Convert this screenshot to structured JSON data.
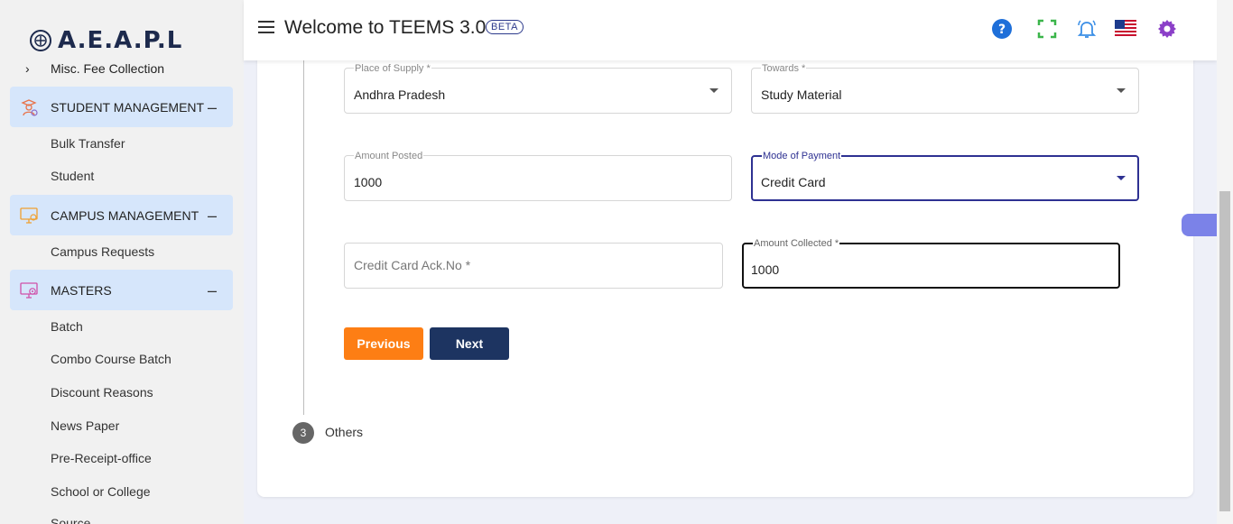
{
  "sidebar": {
    "logo_text": "A.E.A.P.L",
    "misc_item": "Misc. Fee Collection",
    "sections": [
      {
        "title": "STUDENT MANAGEMENT",
        "toggle": "–",
        "items": [
          "Bulk Transfer",
          "Student"
        ]
      },
      {
        "title": "CAMPUS MANAGEMENT",
        "toggle": "–",
        "items": [
          "Campus Requests"
        ]
      },
      {
        "title": "MASTERS",
        "toggle": "–",
        "items": [
          "Batch",
          "Combo Course Batch",
          "Discount Reasons",
          "News Paper",
          "Pre-Receipt-office",
          "School or College",
          "Source"
        ]
      }
    ]
  },
  "header": {
    "title": "Welcome to TEEMS 3.0",
    "badge": "BETA",
    "icons": [
      "help-icon",
      "fullscreen-icon",
      "notification-bell-icon",
      "us-flag-icon",
      "settings-gear-icon"
    ]
  },
  "form": {
    "place_of_supply": {
      "label": "Place of Supply *",
      "value": "Andhra Pradesh"
    },
    "towards": {
      "label": "Towards *",
      "value": "Study Material"
    },
    "amount_posted": {
      "label": "Amount Posted",
      "value": "1000"
    },
    "mode_of_payment": {
      "label": "Mode of Payment",
      "value": "Credit Card"
    },
    "credit_card_ack": {
      "placeholder": "Credit Card Ack.No *"
    },
    "amount_collected": {
      "label": "Amount Collected *",
      "value": "1000"
    }
  },
  "buttons": {
    "previous": "Previous",
    "next": "Next"
  },
  "step": {
    "number": "3",
    "label": "Others"
  },
  "colors": {
    "primary": "#2e3192",
    "orange": "#fd7e14",
    "navy": "#1d3461",
    "section_bg": "#d6e6fb"
  }
}
